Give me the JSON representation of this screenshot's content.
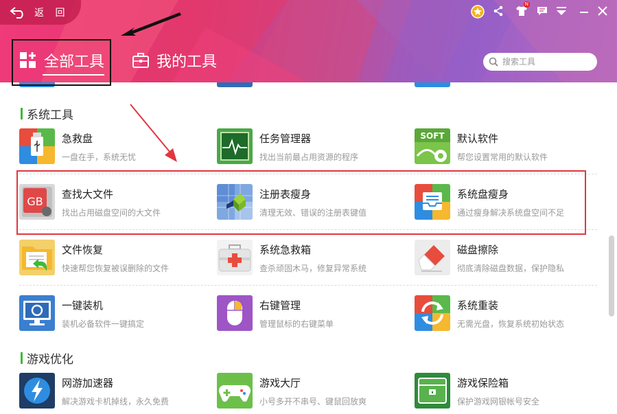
{
  "header": {
    "back_label": "返 回",
    "tabs": [
      {
        "label": "全部工具",
        "active": true
      },
      {
        "label": "我的工具",
        "active": false
      }
    ],
    "search": {
      "placeholder": "搜索工具",
      "value": ""
    },
    "notification_badge": "N"
  },
  "sections": [
    {
      "title": "系统工具",
      "tools": [
        {
          "name": "急救盘",
          "desc": "一盘在手，系统无忧",
          "icon": "usb-rescue-icon"
        },
        {
          "name": "任务管理器",
          "desc": "找出当前最占用资源的程序",
          "icon": "task-monitor-icon"
        },
        {
          "name": "默认软件",
          "desc": "帮您设置常用的默认软件",
          "icon": "soft-gear-icon"
        },
        {
          "name": "查找大文件",
          "desc": "找出占用磁盘空间的大文件",
          "icon": "gb-file-icon"
        },
        {
          "name": "注册表瘦身",
          "desc": "清理无效、错误的注册表键值",
          "icon": "registry-cube-icon"
        },
        {
          "name": "系统盘瘦身",
          "desc": "通过瘦身解决系统盘空间不足",
          "icon": "disk-tray-icon"
        },
        {
          "name": "文件恢复",
          "desc": "快速帮您恢复被误删除的文件",
          "icon": "folder-restore-icon"
        },
        {
          "name": "系统急救箱",
          "desc": "查杀顽固木马，修复异常系统",
          "icon": "first-aid-kit-icon"
        },
        {
          "name": "磁盘擦除",
          "desc": "彻底清除磁盘数据，保护隐私",
          "icon": "eraser-icon"
        },
        {
          "name": "一键装机",
          "desc": "装机必备软件一键搞定",
          "icon": "monitor-install-icon"
        },
        {
          "name": "右键管理",
          "desc": "管理鼠标的右键菜单",
          "icon": "mouse-icon"
        },
        {
          "name": "系统重装",
          "desc": "无需光盘，恢复系统初始状态",
          "icon": "reinstall-arrows-icon"
        }
      ]
    },
    {
      "title": "游戏优化",
      "tools": [
        {
          "name": "网游加速器",
          "desc": "解决游戏卡机掉线，永久免费",
          "icon": "lightning-icon"
        },
        {
          "name": "游戏大厅",
          "desc": "小号多开不串号、键鼠回放爽",
          "icon": "gamepad-icon"
        },
        {
          "name": "游戏保险箱",
          "desc": "保护游戏网银帐号安全",
          "icon": "safe-box-icon"
        }
      ]
    }
  ],
  "icon_labels": {
    "soft": "SOFT",
    "gb": "GB"
  },
  "colors": {
    "section_bar": "#3dba3a",
    "highlight_red": "#e0373f",
    "annotation_black": "#111111"
  }
}
